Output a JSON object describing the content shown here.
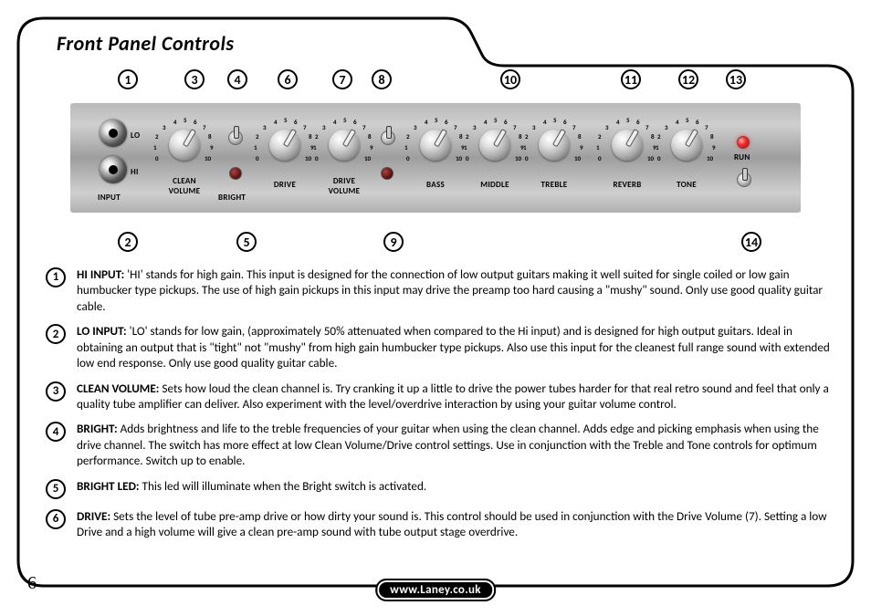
{
  "page": {
    "title": "Front Panel Controls",
    "page_number": "6",
    "footer_url": "www.Laney.co.uk"
  },
  "panel": {
    "input_label": "INPUT",
    "lo_label": "LO",
    "hi_label": "HI",
    "run_label": "RUN",
    "knobs": [
      {
        "id": "clean_volume",
        "label": "CLEAN\nVOLUME"
      },
      {
        "id": "bright",
        "label": "BRIGHT"
      },
      {
        "id": "drive",
        "label": "DRIVE"
      },
      {
        "id": "drive_volume",
        "label": "DRIVE\nVOLUME"
      },
      {
        "id": "bass",
        "label": "BASS"
      },
      {
        "id": "middle",
        "label": "MIDDLE"
      },
      {
        "id": "treble",
        "label": "TREBLE"
      },
      {
        "id": "reverb",
        "label": "REVERB"
      },
      {
        "id": "tone",
        "label": "TONE"
      }
    ],
    "knob_scale": [
      "0",
      "1",
      "2",
      "3",
      "4",
      "5",
      "6",
      "7",
      "8",
      "9",
      "10"
    ]
  },
  "top_callouts": {
    "c1": "1",
    "c3": "3",
    "c4": "4",
    "c6": "6",
    "c7": "7",
    "c8": "8",
    "c10": "10",
    "c11": "11",
    "c12": "12",
    "c13": "13"
  },
  "bottom_callouts": {
    "c2": "2",
    "c5": "5",
    "c9": "9",
    "c14": "14"
  },
  "descriptions": [
    {
      "num": "1",
      "term": "HI INPUT:",
      "text": " 'HI' stands for high gain.  This input is designed for the connection of low output guitars making it well suited for single coiled or low gain humbucker type pickups.  The use of high gain pickups in this input may drive the preamp too hard causing a \"mushy\" sound.  Only use good quality guitar cable."
    },
    {
      "num": "2",
      "term": "LO INPUT:",
      "text": " 'LO' stands for low gain, (approximately 50% attenuated when compared to the Hi input) and is designed for high output guitars. Ideal in obtaining an output that is \"tight\" not \"mushy\" from high gain humbucker type pickups. Also use this input for the cleanest full range sound with extended low end response. Only use good quality guitar cable."
    },
    {
      "num": "3",
      "term": "CLEAN VOLUME:",
      "text": " Sets how loud the clean channel is.  Try cranking it up a little to drive the power tubes harder for that real retro sound and feel that only a quality tube amplifier can deliver.  Also experiment with the level/overdrive interaction by using your guitar volume control."
    },
    {
      "num": "4",
      "term": "BRIGHT:",
      "text": " Adds brightness and life to the treble frequencies of your guitar when using the clean channel.  Adds edge and picking emphasis when using the drive channel.  The switch has more effect at low Clean Volume/Drive control settings.  Use in conjunction with the Treble and Tone controls for optimum performance. Switch up to enable."
    },
    {
      "num": "5",
      "term": "BRIGHT LED:",
      "text": " This led will illuminate when the Bright switch is activated."
    },
    {
      "num": "6",
      "term": "DRIVE:",
      "text": " Sets the level of tube pre-amp drive or how dirty your sound is.  This control should be used in conjunction with the Drive Volume (7). Setting a low Drive and a high volume will give a clean pre-amp sound with tube output stage overdrive."
    }
  ]
}
